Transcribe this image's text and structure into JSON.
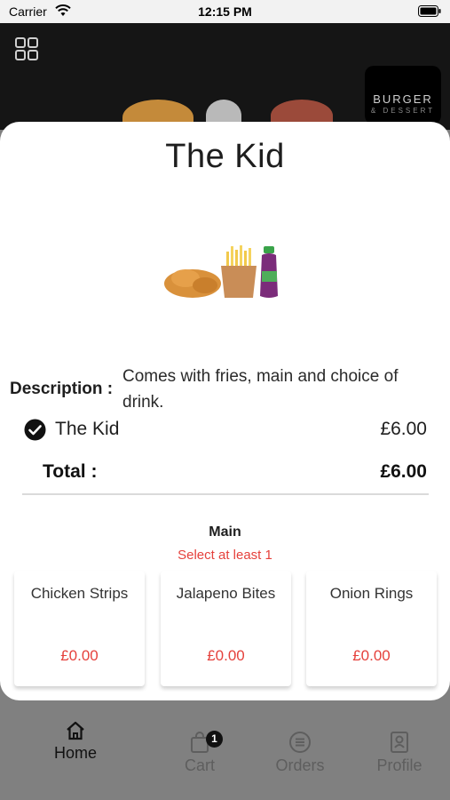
{
  "status_bar": {
    "carrier": "Carrier",
    "time": "12:15 PM"
  },
  "background": {
    "brand_logo": {
      "title": "BURGER",
      "subtitle": "& DESSERT"
    }
  },
  "modal": {
    "title": "The Kid",
    "description_label": "Description :",
    "description": "Comes with fries, main and choice of drink.",
    "selected_item": {
      "name": "The Kid",
      "price": "£6.00"
    },
    "total_label": "Total :",
    "total_value": "£6.00",
    "section": {
      "title": "Main",
      "subtitle": "Select at least 1",
      "options": [
        {
          "name": "Chicken Strips",
          "price": "£0.00"
        },
        {
          "name": "Jalapeno Bites",
          "price": "£0.00"
        },
        {
          "name": "Onion Rings",
          "price": "£0.00"
        }
      ]
    }
  },
  "tab_bar": {
    "tabs": [
      {
        "label": "Home",
        "icon": "home-icon",
        "active": true
      },
      {
        "label": "Cart",
        "icon": "cart-icon",
        "badge": "1"
      },
      {
        "label": "Orders",
        "icon": "orders-icon"
      },
      {
        "label": "Profile",
        "icon": "profile-icon"
      }
    ]
  },
  "colors": {
    "accent_red": "#e5413c",
    "text_dark": "#1e1e1e",
    "overlay": "#808080"
  }
}
